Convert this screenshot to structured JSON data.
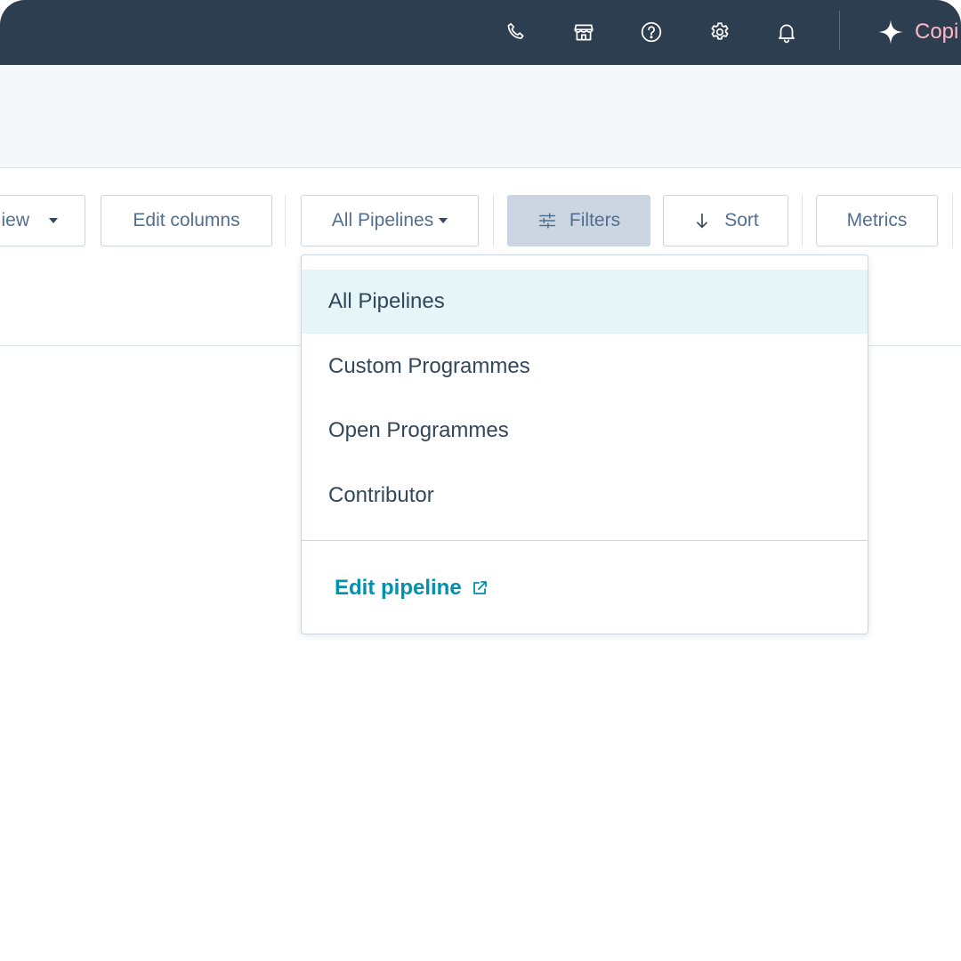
{
  "topnav": {
    "icons": [
      {
        "name": "phone-icon"
      },
      {
        "name": "marketplace-icon"
      },
      {
        "name": "help-icon"
      },
      {
        "name": "settings-gear-icon"
      },
      {
        "name": "notifications-bell-icon"
      }
    ],
    "copilot_label": "Copi",
    "copilot_color": "#ffb9c6"
  },
  "toolbar": {
    "view_label": "iew",
    "edit_columns_label": "Edit columns",
    "pipeline_select_label": "All Pipelines",
    "filters_label": "Filters",
    "sort_label": "Sort",
    "metrics_label": "Metrics"
  },
  "pipeline_menu": {
    "items": [
      {
        "label": "All Pipelines",
        "selected": true
      },
      {
        "label": "Custom Programmes",
        "selected": false
      },
      {
        "label": "Open Programmes",
        "selected": false
      },
      {
        "label": "Contributor",
        "selected": false
      }
    ],
    "edit_link_label": "Edit pipeline"
  },
  "colors": {
    "nav_bg": "#2d3e50",
    "accent_link": "#0091ae",
    "selected_bg": "#e5f5f8",
    "text": "#33475b"
  }
}
